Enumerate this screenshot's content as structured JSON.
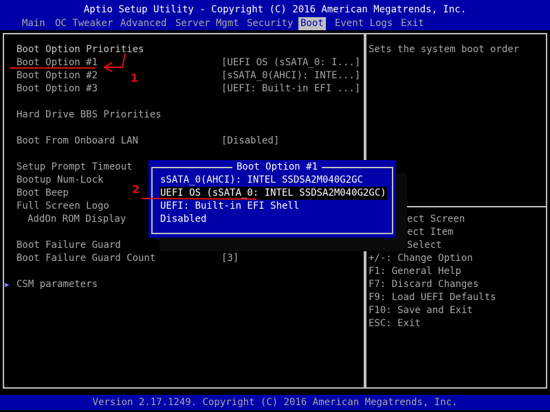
{
  "title": "Aptio Setup Utility - Copyright (C) 2016 American Megatrends, Inc.",
  "menu": {
    "items": [
      {
        "label": "Main"
      },
      {
        "label": "OC Tweaker"
      },
      {
        "label": "Advanced"
      },
      {
        "label": "Server Mgmt"
      },
      {
        "label": "Security"
      },
      {
        "label": "Boot",
        "active": true
      },
      {
        "label": "Event Logs"
      },
      {
        "label": "Exit"
      }
    ]
  },
  "main": {
    "section_title": "Boot Option Priorities",
    "options": [
      {
        "label": "Boot Option #1",
        "value": "[UEFI OS (sSATA_0: I...]"
      },
      {
        "label": "Boot Option #2",
        "value": "[sSATA_0(AHCI): INTE...]"
      },
      {
        "label": "Boot Option #3",
        "value": "[UEFI: Built-in EFI ...]"
      },
      {
        "label": "Hard Drive BBS Priorities",
        "value": ""
      },
      {
        "label": "Boot From Onboard LAN",
        "value": "[Disabled]"
      },
      {
        "label": "Setup Prompt Timeout",
        "value": ""
      },
      {
        "label": "Bootup Num-Lock",
        "value": ""
      },
      {
        "label": "Boot Beep",
        "value": ""
      },
      {
        "label": "Full Screen Logo",
        "value": ""
      },
      {
        "label": "AddOn ROM Display",
        "value": ""
      },
      {
        "label": "Boot Failure Guard",
        "value": ""
      },
      {
        "label": "Boot Failure Guard Count",
        "value": "[3]"
      },
      {
        "label": "CSM parameters",
        "value": "",
        "submenu_marker": "▶"
      }
    ]
  },
  "help": {
    "description": "Sets the system boot order",
    "keys": [
      "ect Screen",
      "ect Item",
      "Select",
      "+/-: Change Option",
      "F1: General Help",
      "F7: Discard Changes",
      "F9: Load UEFI Defaults",
      "F10: Save and Exit",
      "ESC: Exit"
    ]
  },
  "popup": {
    "title": "Boot Option #1",
    "items": [
      {
        "label": "sSATA_0(AHCI): INTEL SSDSA2M040G2GC"
      },
      {
        "label": "UEFI OS (sSATA_0: INTEL SSDSA2M040G2GC)",
        "selected": true
      },
      {
        "label": "UEFI: Built-in EFI Shell"
      },
      {
        "label": "Disabled"
      }
    ]
  },
  "annotations": {
    "first": "1",
    "second": "2"
  },
  "footer": "Version 2.17.1249. Copyright (C) 2016 American Megatrends, Inc.",
  "colors": {
    "bios_blue": "#0000a8",
    "highlight_gray": "#c0c0c0",
    "annotation_red": "#e01010"
  }
}
